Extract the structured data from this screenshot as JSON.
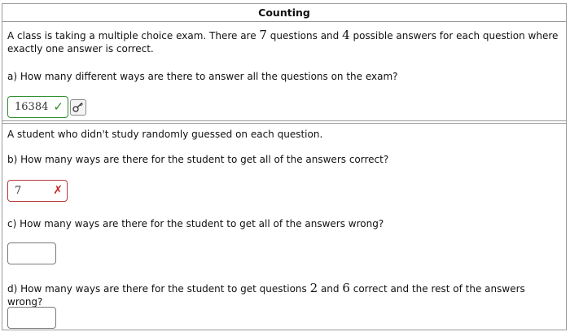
{
  "title": "Counting",
  "q1": {
    "intro_pre": "A class is taking a multiple choice exam. There are ",
    "num_questions": "7",
    "intro_mid": " questions and ",
    "num_answers": "4",
    "intro_post": " possible answers for each question where exactly one answer is correct.",
    "part_a": "a) How many different ways are there to answer all the questions on the exam?",
    "answer_a": "16384",
    "answer_a_status": "correct"
  },
  "q2": {
    "intro": "A student who didn't study randomly guessed on each question.",
    "part_b": "b) How many ways are there for the student to get all of the answers correct?",
    "answer_b": "7",
    "answer_b_status": "incorrect",
    "part_c": "c) How many ways are there for the student to get all of the answers wrong?",
    "answer_c": "",
    "part_d_pre": "d) How many ways are there for the student to get questions ",
    "part_d_q1": "2",
    "part_d_mid": " and ",
    "part_d_q2": "6",
    "part_d_post": " correct and the rest of the answers wrong?",
    "answer_d": ""
  },
  "icons": {
    "check": "check-icon",
    "cross": "x-icon",
    "key": "key-icon"
  },
  "colors": {
    "correct": "#2e8b2e",
    "incorrect": "#cc2222"
  }
}
